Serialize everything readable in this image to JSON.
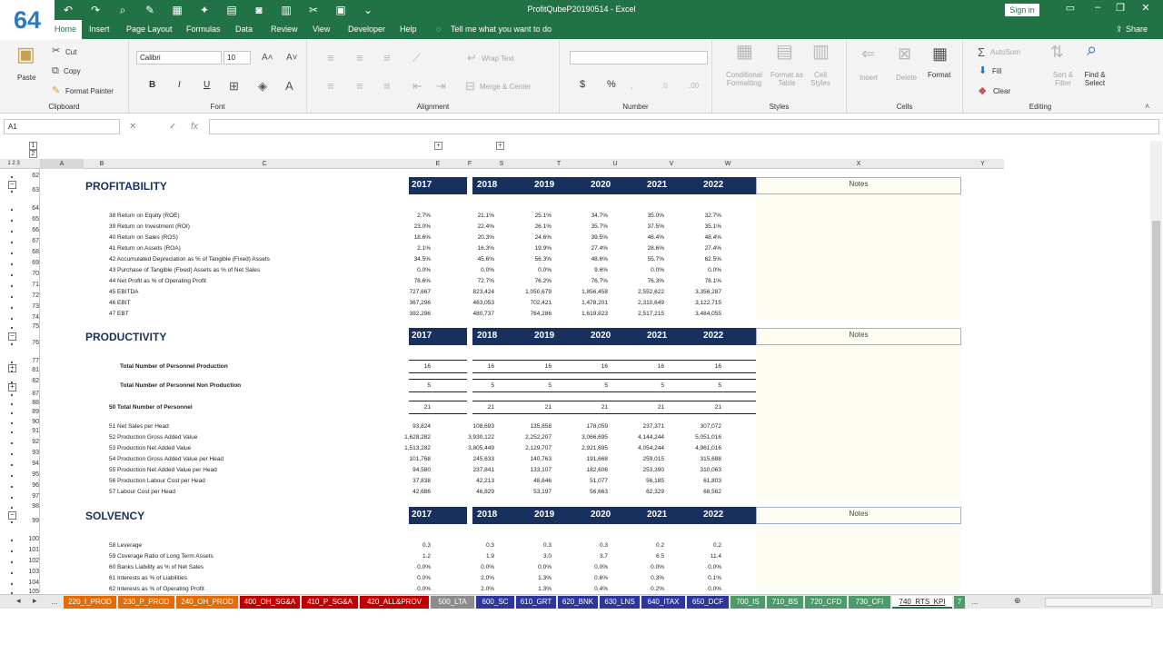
{
  "window": {
    "title": "ProfitQubeP20190514  -  Excel",
    "signin": "Sign in",
    "share": "Share",
    "badge": "64"
  },
  "qat_icons": [
    "undo-icon",
    "redo-icon",
    "print-preview-icon",
    "format-icon",
    "table-icon",
    "wand-icon",
    "calculator-icon",
    "camera-icon",
    "chart-icon",
    "cut-icon",
    "paste-icon",
    "more-icon"
  ],
  "tabs": [
    "Home",
    "Insert",
    "Page Layout",
    "Formulas",
    "Data",
    "Review",
    "View",
    "Developer",
    "Help"
  ],
  "tellme": "Tell me what you want to do",
  "ribbon": {
    "clipboard": {
      "paste": "Paste",
      "cut": "Cut",
      "copy": "Copy",
      "format_painter": "Format Painter",
      "label": "Clipboard"
    },
    "font": {
      "name": "Calibri",
      "size": "10",
      "label": "Font",
      "bold": "B",
      "italic": "I",
      "underline": "U"
    },
    "alignment": {
      "wrap": "Wrap Text",
      "merge": "Merge & Center",
      "label": "Alignment"
    },
    "number": {
      "label": "Number",
      "currency": "$",
      "percent": "%"
    },
    "styles": {
      "cond": "Conditional Formatting",
      "table": "Format as Table",
      "cell": "Cell Styles",
      "label": "Styles"
    },
    "cells": {
      "insert": "Insert",
      "delete": "Delete",
      "format": "Format",
      "label": "Cells"
    },
    "editing": {
      "autosum": "AutoSum",
      "fill": "Fill",
      "clear": "Clear",
      "sort": "Sort & Filter",
      "find": "Find & Select",
      "label": "Editing"
    }
  },
  "namebox": "A1",
  "fx": "fx",
  "outline_levels": [
    "1",
    "2",
    "3"
  ],
  "columns": [
    "A",
    "B",
    "C",
    "E",
    "F",
    "S",
    "T",
    "U",
    "V",
    "W",
    "X",
    "Y"
  ],
  "years": [
    "2017",
    "2018",
    "2019",
    "2020",
    "2021",
    "2022"
  ],
  "notes": "Notes",
  "sections": {
    "profitability": {
      "title": "PROFITABILITY",
      "rows": [
        {
          "n": "38",
          "label": "Return on Equity (ROE)",
          "v": [
            "2.7%",
            "21.1%",
            "25.1%",
            "34.7%",
            "35.0%",
            "32.7%"
          ]
        },
        {
          "n": "39",
          "label": "Return on Investment (ROI)",
          "v": [
            "23.0%",
            "22.4%",
            "26.1%",
            "35.7%",
            "37.5%",
            "35.1%"
          ]
        },
        {
          "n": "40",
          "label": "Return on Sales (ROS)",
          "v": [
            "18.6%",
            "20.3%",
            "24.6%",
            "39.5%",
            "46.4%",
            "48.4%"
          ]
        },
        {
          "n": "41",
          "label": "Return on Assets (ROA)",
          "v": [
            "2.1%",
            "16.3%",
            "19.9%",
            "27.4%",
            "28.6%",
            "27.4%"
          ]
        },
        {
          "n": "42",
          "label": "Accumulated Depreciation as % of Tangible (Fixed) Assets",
          "v": [
            "34.5%",
            "45.6%",
            "56.3%",
            "48.6%",
            "55.7%",
            "62.5%"
          ]
        },
        {
          "n": "43",
          "label": "Purchase of Tangible (Fixed) Assets as % of Net Sales",
          "v": [
            "0.0%",
            "0.0%",
            "0.0%",
            "9.6%",
            "0.0%",
            "0.0%"
          ]
        },
        {
          "n": "44",
          "label": "Net Profit as % of Operating Profit",
          "v": [
            "78.6%",
            "72.7%",
            "76.2%",
            "76.7%",
            "76.3%",
            "78.1%"
          ]
        },
        {
          "n": "45",
          "label": "EBITDA",
          "v": [
            "727,667",
            "823,424",
            "1,050,679",
            "1,856,458",
            "2,552,622",
            "3,356,287"
          ]
        },
        {
          "n": "46",
          "label": "EBIT",
          "v": [
            "367,296",
            "463,053",
            "702,421",
            "1,478,201",
            "2,310,649",
            "3,122,715"
          ]
        },
        {
          "n": "47",
          "label": "EBT",
          "v": [
            "392,296",
            "480,737",
            "764,286",
            "1,619,823",
            "2,517,215",
            "3,484,055"
          ]
        }
      ]
    },
    "productivity": {
      "title": "PRODUCTIVITY",
      "totals": [
        {
          "label": "Total Number of Personnel Production",
          "v": [
            "16",
            "16",
            "16",
            "16",
            "16",
            "16"
          ]
        },
        {
          "label": "Total Number of Personnel Non Production",
          "v": [
            "5",
            "5",
            "5",
            "5",
            "5",
            "5"
          ]
        },
        {
          "n": "50",
          "label": "Total Number of Personnel",
          "v": [
            "21",
            "21",
            "21",
            "21",
            "21",
            "21"
          ]
        }
      ],
      "rows": [
        {
          "n": "51",
          "label": "Net Sales per Head",
          "v": [
            "93,824",
            "108,693",
            "135,858",
            "178,059",
            "237,371",
            "307,072"
          ]
        },
        {
          "n": "52",
          "label": "Production Gross Added Value",
          "v": [
            "1,628,282",
            "3,930,122",
            "2,252,207",
            "3,066,695",
            "4,144,244",
            "5,051,016"
          ]
        },
        {
          "n": "53",
          "label": "Production Net Added Value",
          "v": [
            "1,513,282",
            "3,805,449",
            "2,129,707",
            "2,921,695",
            "4,054,244",
            "4,961,016"
          ]
        },
        {
          "n": "54",
          "label": "Production Gross Added Value per Head",
          "v": [
            "101,768",
            "245,633",
            "140,763",
            "191,668",
            "259,015",
            "315,688"
          ]
        },
        {
          "n": "55",
          "label": "Production Net Added Value per Head",
          "v": [
            "94,580",
            "237,841",
            "133,107",
            "182,606",
            "253,390",
            "310,063"
          ]
        },
        {
          "n": "56",
          "label": "Production Labour Cost per Head",
          "v": [
            "37,838",
            "42,213",
            "48,646",
            "51,077",
            "56,185",
            "61,803"
          ]
        },
        {
          "n": "57",
          "label": "Labour Cost per Head",
          "v": [
            "42,686",
            "46,829",
            "53,197",
            "56,663",
            "62,329",
            "68,562"
          ]
        }
      ]
    },
    "solvency": {
      "title": "SOLVENCY",
      "rows": [
        {
          "n": "58",
          "label": "Leverage",
          "v": [
            "0.3",
            "0.3",
            "0.3",
            "0.3",
            "0.2",
            "0.2"
          ]
        },
        {
          "n": "59",
          "label": "Coverage Ratio of Long Term Assets",
          "v": [
            "1.2",
            "1.9",
            "3.0",
            "3.7",
            "6.5",
            "11.4"
          ]
        },
        {
          "n": "60",
          "label": "Banks Liability as % of Net Sales",
          "v": [
            "0.0%",
            "0.0%",
            "0.0%",
            "0.0%",
            "0.0%",
            "0.0%"
          ]
        },
        {
          "n": "61",
          "label": "Interests as % of Liabilities",
          "v": [
            "0.0%",
            "2.0%",
            "1.3%",
            "0.6%",
            "0.3%",
            "0.1%"
          ]
        },
        {
          "n": "62",
          "label": "Interests as % of Operating Profit",
          "v": [
            "0.0%",
            "2.0%",
            "1.3%",
            "0.4%",
            "0.2%",
            "0.0%"
          ]
        }
      ]
    }
  },
  "row_numbers": [
    "62",
    "63",
    "64",
    "65",
    "66",
    "67",
    "68",
    "69",
    "70",
    "71",
    "72",
    "73",
    "74",
    "75",
    "76",
    "77",
    "81",
    "82",
    "87",
    "88",
    "89",
    "90",
    "91",
    "92",
    "93",
    "94",
    "95",
    "96",
    "97",
    "98",
    "99",
    "100",
    "101",
    "102",
    "103",
    "104",
    "105"
  ],
  "sheets": [
    {
      "name": "...",
      "color": "#e8e8e8",
      "fg": "#333"
    },
    {
      "name": "220_I_PROD",
      "color": "#e36c09",
      "fg": "#fff"
    },
    {
      "name": "230_P_PROD",
      "color": "#e36c09",
      "fg": "#fff"
    },
    {
      "name": "240_OH_PROD",
      "color": "#e36c09",
      "fg": "#fff"
    },
    {
      "name": "400_OH_SG&A",
      "color": "#c00000",
      "fg": "#fff"
    },
    {
      "name": "410_P_SG&A",
      "color": "#c00000",
      "fg": "#fff"
    },
    {
      "name": "420_ALL&PROV",
      "color": "#c00000",
      "fg": "#fff"
    },
    {
      "name": "500_LTA",
      "color": "#8c8c8c",
      "fg": "#fff"
    },
    {
      "name": "600_SC",
      "color": "#2f3699",
      "fg": "#fff"
    },
    {
      "name": "610_GRT",
      "color": "#2f3699",
      "fg": "#fff"
    },
    {
      "name": "620_BNK",
      "color": "#2f3699",
      "fg": "#fff"
    },
    {
      "name": "630_LNS",
      "color": "#2f3699",
      "fg": "#fff"
    },
    {
      "name": "640_ITAX",
      "color": "#2f3699",
      "fg": "#fff"
    },
    {
      "name": "650_DCF",
      "color": "#2f3699",
      "fg": "#fff"
    },
    {
      "name": "700_IS",
      "color": "#4e9a6a",
      "fg": "#fff"
    },
    {
      "name": "710_BS",
      "color": "#4e9a6a",
      "fg": "#fff"
    },
    {
      "name": "720_CFD",
      "color": "#4e9a6a",
      "fg": "#fff"
    },
    {
      "name": "730_CFI",
      "color": "#4e9a6a",
      "fg": "#fff"
    },
    {
      "name": "740_RTS_KPI",
      "color": "#ffffff",
      "fg": "#222"
    },
    {
      "name": "7",
      "color": "#4e9a6a",
      "fg": "#fff"
    },
    {
      "name": "...",
      "color": "#e8e8e8",
      "fg": "#333"
    }
  ],
  "colors": {
    "green": "#217346",
    "navy": "#17305e",
    "notes": "#fdfdf3"
  }
}
